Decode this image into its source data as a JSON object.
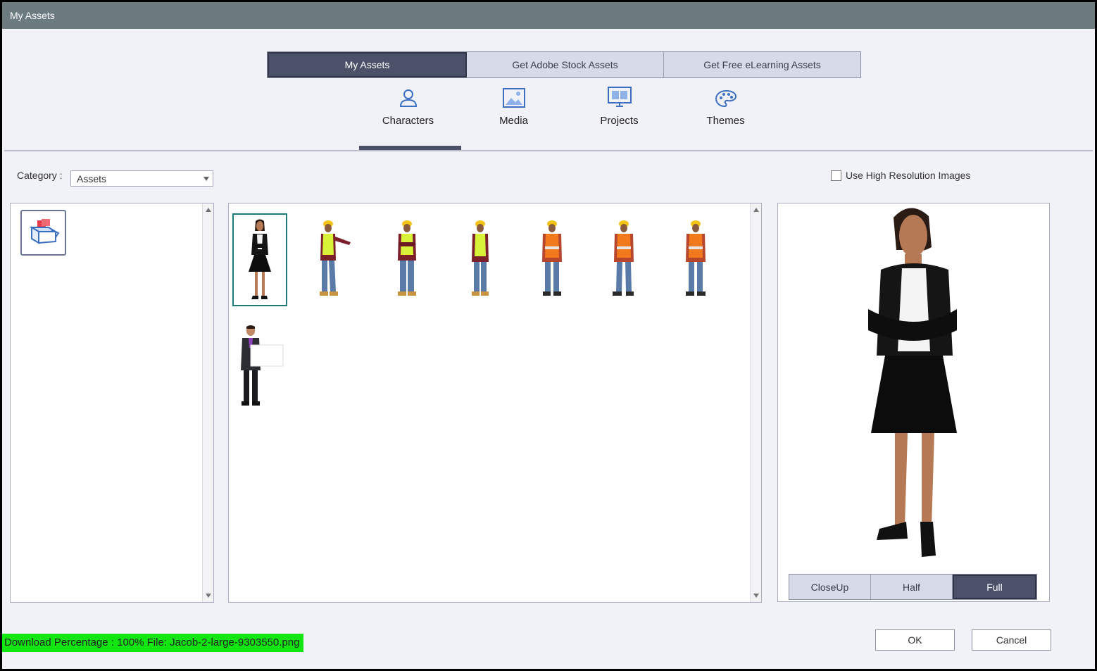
{
  "window": {
    "title": "My Assets"
  },
  "source_tabs": [
    {
      "label": "My Assets",
      "active": true
    },
    {
      "label": "Get Adobe Stock Assets",
      "active": false
    },
    {
      "label": "Get Free eLearning Assets",
      "active": false
    }
  ],
  "category_tabs": [
    {
      "label": "Characters",
      "icon": "person-icon",
      "active": true
    },
    {
      "label": "Media",
      "icon": "image-icon",
      "active": false
    },
    {
      "label": "Projects",
      "icon": "monitor-icon",
      "active": false
    },
    {
      "label": "Themes",
      "icon": "palette-icon",
      "active": false
    }
  ],
  "category": {
    "label": "Category :",
    "selected": "Assets"
  },
  "high_res": {
    "label": "Use High Resolution Images",
    "checked": false
  },
  "characters": [
    {
      "name": "woman-arms-crossed",
      "selected": true
    },
    {
      "name": "worker-pointing",
      "selected": false
    },
    {
      "name": "worker-arms-crossed",
      "selected": false
    },
    {
      "name": "worker-standing",
      "selected": false
    },
    {
      "name": "worker-orange-vest-1",
      "selected": false
    },
    {
      "name": "worker-orange-vest-2",
      "selected": false
    },
    {
      "name": "worker-orange-vest-3",
      "selected": false
    },
    {
      "name": "businessman-holding-sign",
      "selected": false
    }
  ],
  "preview_views": [
    {
      "label": "CloseUp",
      "active": false
    },
    {
      "label": "Half",
      "active": false
    },
    {
      "label": "Full",
      "active": true
    }
  ],
  "status": {
    "text": "Download Percentage : 100%   File: Jacob-2-large-9303550.png"
  },
  "buttons": {
    "ok": "OK",
    "cancel": "Cancel"
  },
  "colors": {
    "accent": "#4b5169",
    "titlebar": "#6b7b80",
    "status_bg": "#11e611",
    "selection": "#1e7a78"
  }
}
